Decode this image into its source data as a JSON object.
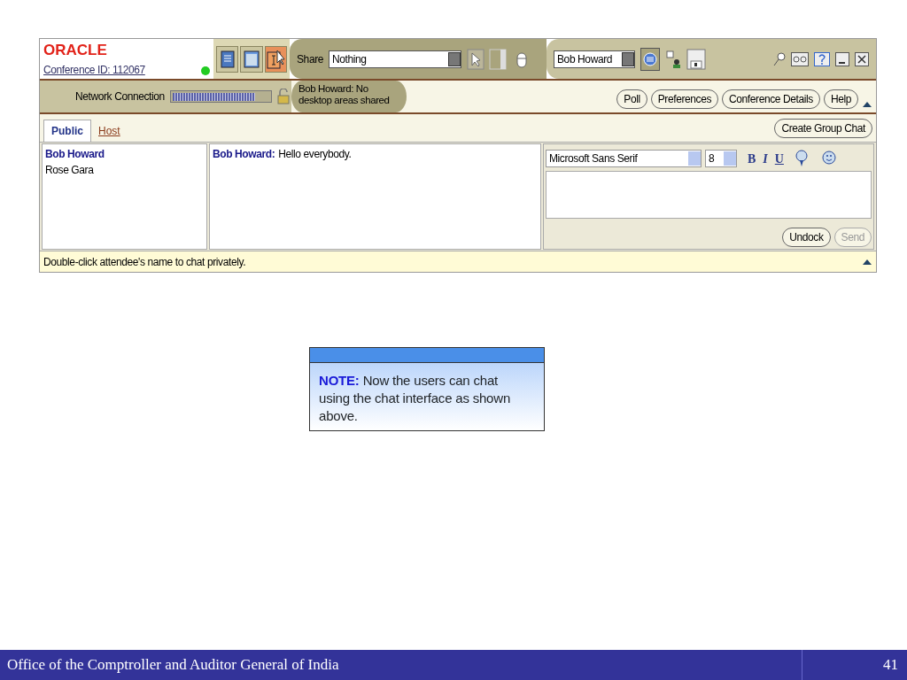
{
  "app": {
    "logo": "ORACLE",
    "conference_id": "Conference ID: 112067",
    "mode_buttons": [
      {
        "selected": false
      },
      {
        "selected": false
      },
      {
        "selected": true
      }
    ],
    "share": {
      "label": "Share",
      "value": "Nothing"
    },
    "presenter": {
      "value": "Bob Howard"
    },
    "network": {
      "label": "Network Connection",
      "level": 0.85
    },
    "share_status": "Bob Howard: No desktop areas shared",
    "buttons": [
      "Poll",
      "Preferences",
      "Conference Details",
      "Help"
    ],
    "tabs": [
      {
        "label": "Public",
        "selected": true
      },
      {
        "label": "Host",
        "selected": false
      }
    ],
    "create_group_chat": "Create Group Chat",
    "attendees": [
      {
        "name": "Bob Howard",
        "kind": "self"
      },
      {
        "name": "Rose Gara",
        "kind": "other"
      }
    ],
    "messages": [
      {
        "sender": "Bob Howard:",
        "text": "Hello everybody."
      }
    ],
    "font": {
      "family": "Microsoft Sans Serif",
      "size": "8"
    },
    "format_buttons": [
      "B",
      "I",
      "U"
    ],
    "undock": "Undock",
    "send": {
      "label": "Send",
      "disabled": true
    },
    "status_bar": "Double-click attendee's name to chat privately."
  },
  "note": "**NOTE:** Now the users can chat using the chat interface as shown above.",
  "footer": {
    "org": "Office of the Comptroller and Auditor General of India",
    "page": "41"
  }
}
